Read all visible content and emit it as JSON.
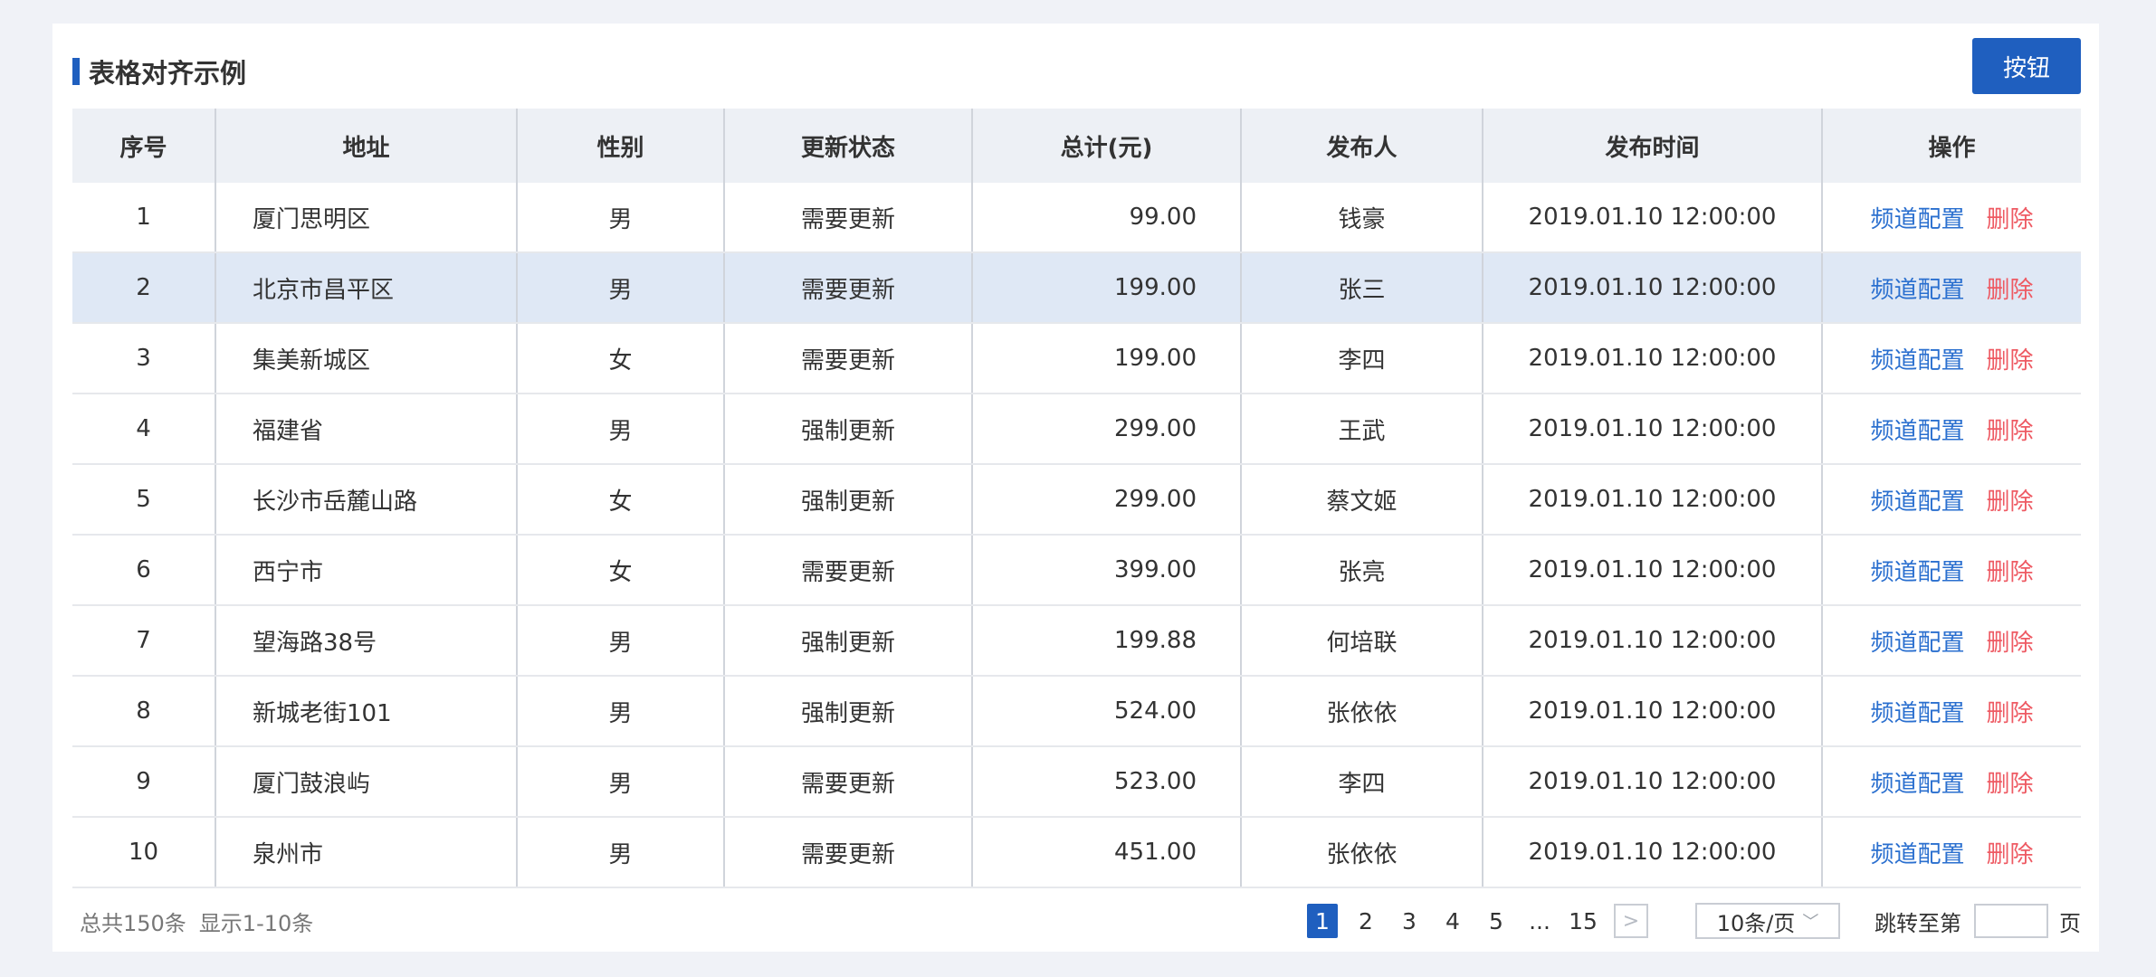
{
  "title": "表格对齐示例",
  "top_button": "按钮",
  "columns": [
    "序号",
    "地址",
    "性别",
    "更新状态",
    "总计(元)",
    "发布人",
    "发布时间",
    "操作"
  ],
  "rows": [
    {
      "no": "1",
      "address": "厦门思明区",
      "gender": "男",
      "status": "需要更新",
      "total": "99.00",
      "publisher": "钱豪",
      "time": "2019.01.10 12:00:00"
    },
    {
      "no": "2",
      "address": "北京市昌平区",
      "gender": "男",
      "status": "需要更新",
      "total": "199.00",
      "publisher": "张三",
      "time": "2019.01.10 12:00:00"
    },
    {
      "no": "3",
      "address": "集美新城区",
      "gender": "女",
      "status": "需要更新",
      "total": "199.00",
      "publisher": "李四",
      "time": "2019.01.10 12:00:00"
    },
    {
      "no": "4",
      "address": "福建省",
      "gender": "男",
      "status": "强制更新",
      "total": "299.00",
      "publisher": "王武",
      "time": "2019.01.10 12:00:00"
    },
    {
      "no": "5",
      "address": "长沙市岳麓山路",
      "gender": "女",
      "status": "强制更新",
      "total": "299.00",
      "publisher": "蔡文姬",
      "time": "2019.01.10 12:00:00"
    },
    {
      "no": "6",
      "address": "西宁市",
      "gender": "女",
      "status": "需要更新",
      "total": "399.00",
      "publisher": "张亮",
      "time": "2019.01.10 12:00:00"
    },
    {
      "no": "7",
      "address": "望海路38号",
      "gender": "男",
      "status": "强制更新",
      "total": "199.88",
      "publisher": "何培联",
      "time": "2019.01.10 12:00:00"
    },
    {
      "no": "8",
      "address": "新城老街101",
      "gender": "男",
      "status": "强制更新",
      "total": "524.00",
      "publisher": "张依依",
      "time": "2019.01.10 12:00:00"
    },
    {
      "no": "9",
      "address": "厦门鼓浪屿",
      "gender": "男",
      "status": "需要更新",
      "total": "523.00",
      "publisher": "李四",
      "time": "2019.01.10 12:00:00"
    },
    {
      "no": "10",
      "address": "泉州市",
      "gender": "男",
      "status": "需要更新",
      "total": "451.00",
      "publisher": "张依依",
      "time": "2019.01.10 12:00:00"
    }
  ],
  "selected_row": 2,
  "actions": {
    "config": "频道配置",
    "delete": "删除"
  },
  "footer": {
    "total": "总共150条",
    "showing": "显示1-10条",
    "pages": [
      "1",
      "2",
      "3",
      "4",
      "5",
      "...",
      "15"
    ],
    "current_page": "1",
    "next": ">",
    "page_size": "10条/页",
    "jump_label": "跳转至第",
    "jump_value": "",
    "jump_suffix": "页"
  },
  "colors": {
    "accent": "#1f5fbf",
    "link": "#2a6fcf",
    "danger": "#ee5a63",
    "selected_row": "#dfe8f5",
    "header_bg": "#edf0f5"
  }
}
